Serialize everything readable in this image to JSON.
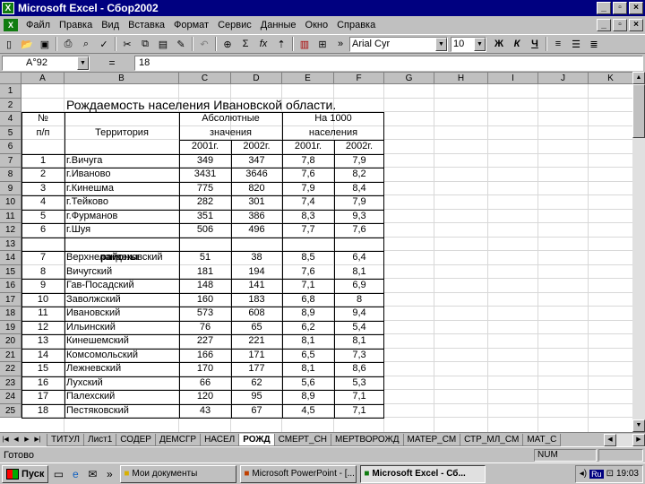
{
  "window": {
    "title": "Microsoft Excel - Сбор2002"
  },
  "menu": [
    "Файл",
    "Правка",
    "Вид",
    "Вставка",
    "Формат",
    "Сервис",
    "Данные",
    "Окно",
    "Справка"
  ],
  "toolbar": {
    "font": "Arial Cyr",
    "size": "10",
    "bold": "Ж",
    "italic": "К",
    "underline": "Ч",
    "sum": "Σ",
    "fx": "fx"
  },
  "formula_bar": {
    "cell_ref": "A°92",
    "eq": "=",
    "value": "18"
  },
  "columns": [
    "A",
    "B",
    "C",
    "D",
    "E",
    "F",
    "G",
    "H",
    "I",
    "J",
    "K"
  ],
  "sheet": {
    "title": "Рождаемость населения Ивановской области.",
    "hdr_num": "№",
    "hdr_pp": "п/п",
    "hdr_territory": "Территория",
    "hdr_abs_1": "Абсолютные",
    "hdr_abs_2": "значения",
    "hdr_per_1": "На 1000",
    "hdr_per_2": "населения",
    "y2001": "2001г.",
    "y2002": "2002г.",
    "y2001b": "2001г.",
    "y2002b": "2002г.",
    "districts_label": "районы"
  },
  "rows": [
    {
      "r": "1"
    },
    {
      "r": "2"
    },
    {
      "r": "4"
    },
    {
      "r": "5"
    },
    {
      "r": "6"
    },
    {
      "r": "7",
      "n": "1",
      "t": "г.Вичуга",
      "a": "349",
      "b": "347",
      "c": "7,8",
      "d": "7,9"
    },
    {
      "r": "8",
      "n": "2",
      "t": "г.Иваново",
      "a": "3431",
      "b": "3646",
      "c": "7,6",
      "d": "8,2"
    },
    {
      "r": "9",
      "n": "3",
      "t": "г.Кинешма",
      "a": "775",
      "b": "820",
      "c": "7,9",
      "d": "8,4"
    },
    {
      "r": "10",
      "n": "4",
      "t": "г.Тейково",
      "a": "282",
      "b": "301",
      "c": "7,4",
      "d": "7,9"
    },
    {
      "r": "11",
      "n": "5",
      "t": "г.Фурманов",
      "a": "351",
      "b": "386",
      "c": "8,3",
      "d": "9,3"
    },
    {
      "r": "12",
      "n": "6",
      "t": "г.Шуя",
      "a": "506",
      "b": "496",
      "c": "7,7",
      "d": "7,6"
    },
    {
      "r": "13"
    },
    {
      "r": "14",
      "n": "7",
      "t": "Верхнеландеховский",
      "a": "51",
      "b": "38",
      "c": "8,5",
      "d": "6,4"
    },
    {
      "r": "15",
      "n": "8",
      "t": "Вичугский",
      "a": "181",
      "b": "194",
      "c": "7,6",
      "d": "8,1"
    },
    {
      "r": "16",
      "n": "9",
      "t": "Гав-Посадский",
      "a": "148",
      "b": "141",
      "c": "7,1",
      "d": "6,9"
    },
    {
      "r": "17",
      "n": "10",
      "t": "Заволжский",
      "a": "160",
      "b": "183",
      "c": "6,8",
      "d": "8"
    },
    {
      "r": "18",
      "n": "11",
      "t": "Ивановский",
      "a": "573",
      "b": "608",
      "c": "8,9",
      "d": "9,4"
    },
    {
      "r": "19",
      "n": "12",
      "t": "Ильинский",
      "a": "76",
      "b": "65",
      "c": "6,2",
      "d": "5,4"
    },
    {
      "r": "20",
      "n": "13",
      "t": "Кинешемский",
      "a": "227",
      "b": "221",
      "c": "8,1",
      "d": "8,1"
    },
    {
      "r": "21",
      "n": "14",
      "t": "Комсомольский",
      "a": "166",
      "b": "171",
      "c": "6,5",
      "d": "7,3"
    },
    {
      "r": "22",
      "n": "15",
      "t": "Лежневский",
      "a": "170",
      "b": "177",
      "c": "8,1",
      "d": "8,6"
    },
    {
      "r": "23",
      "n": "16",
      "t": "Лухский",
      "a": "66",
      "b": "62",
      "c": "5,6",
      "d": "5,3"
    },
    {
      "r": "24",
      "n": "17",
      "t": "Палехский",
      "a": "120",
      "b": "95",
      "c": "8,9",
      "d": "7,1"
    },
    {
      "r": "25",
      "n": "18",
      "t": "Пестяковский",
      "a": "43",
      "b": "67",
      "c": "4,5",
      "d": "7,1"
    }
  ],
  "tabs": [
    "ТИТУЛ",
    "Лист1",
    "СОДЕР",
    "ДЕМСГР",
    "НАСЕЛ",
    "РОЖД",
    "СМЕРТ_СН",
    "МЕРТВОРОЖД",
    "МАТЕР_СМ",
    "СТР_МЛ_СМ",
    "МАТ_С"
  ],
  "active_tab": "РОЖД",
  "status": {
    "text": "Готово",
    "num": "NUM"
  },
  "taskbar": {
    "start": "Пуск",
    "tasks": [
      "Мои документы",
      "Microsoft PowerPoint - [...",
      "Microsoft Excel - Сб..."
    ],
    "lang": "Ru",
    "clock": "19:03"
  }
}
